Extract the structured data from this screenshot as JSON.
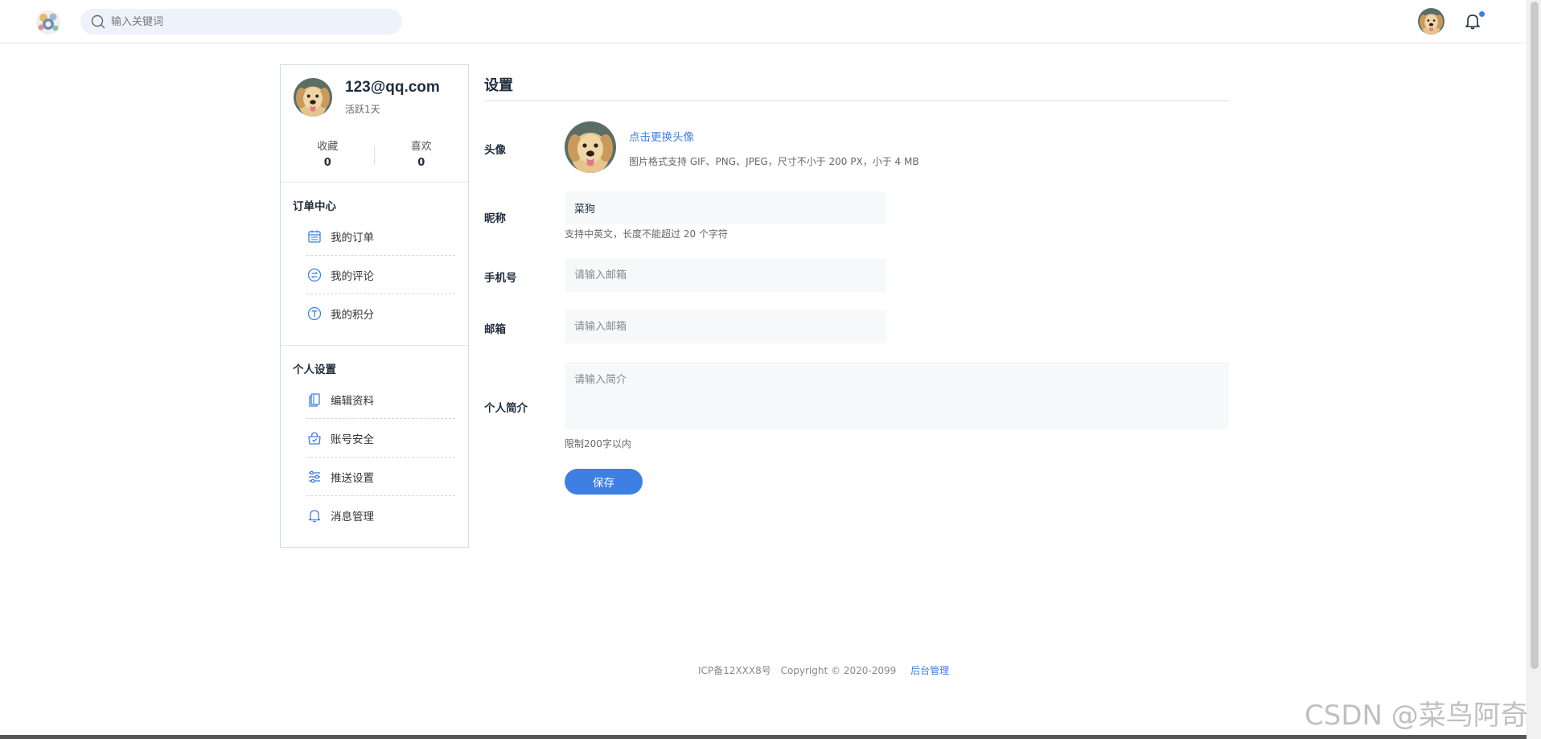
{
  "header": {
    "search_placeholder": "输入关键词",
    "notification_badge_color": "#3d7fe3"
  },
  "sidebar": {
    "email": "123@qq.com",
    "active_days": "活跃1天",
    "stats": [
      {
        "label": "收藏",
        "value": "0"
      },
      {
        "label": "喜欢",
        "value": "0"
      }
    ],
    "order_center": {
      "title": "订单中心",
      "items": [
        {
          "label": "我的订单",
          "icon": "calendar-icon"
        },
        {
          "label": "我的评论",
          "icon": "comment-icon"
        },
        {
          "label": "我的积分",
          "icon": "points-icon"
        }
      ]
    },
    "personal_settings": {
      "title": "个人设置",
      "items": [
        {
          "label": "编辑资料",
          "icon": "copy-icon"
        },
        {
          "label": "账号安全",
          "icon": "shield-bag-icon"
        },
        {
          "label": "推送设置",
          "icon": "sliders-icon"
        },
        {
          "label": "消息管理",
          "icon": "bell-icon"
        }
      ]
    }
  },
  "main": {
    "title": "设置",
    "avatar": {
      "label": "头像",
      "change_link": "点击更换头像",
      "hint": "图片格式支持 GIF、PNG、JPEG，尺寸不小于 200 PX，小于 4 MB"
    },
    "nickname": {
      "label": "昵称",
      "value": "菜狗",
      "hint": "支持中英文，长度不能超过 20 个字符"
    },
    "phone": {
      "label": "手机号",
      "placeholder": "请输入邮箱"
    },
    "email": {
      "label": "邮箱",
      "placeholder": "请输入邮箱"
    },
    "bio": {
      "label": "个人简介",
      "placeholder": "请输入简介",
      "hint": "限制200字以内"
    },
    "save_label": "保存",
    "accent_color": "#3d7fe3"
  },
  "footer": {
    "icp": "ICP备12XXX8号",
    "copyright": "Copyright © 2020-2099",
    "admin_link": "后台管理"
  },
  "watermark": "CSDN @菜鸟阿奇"
}
